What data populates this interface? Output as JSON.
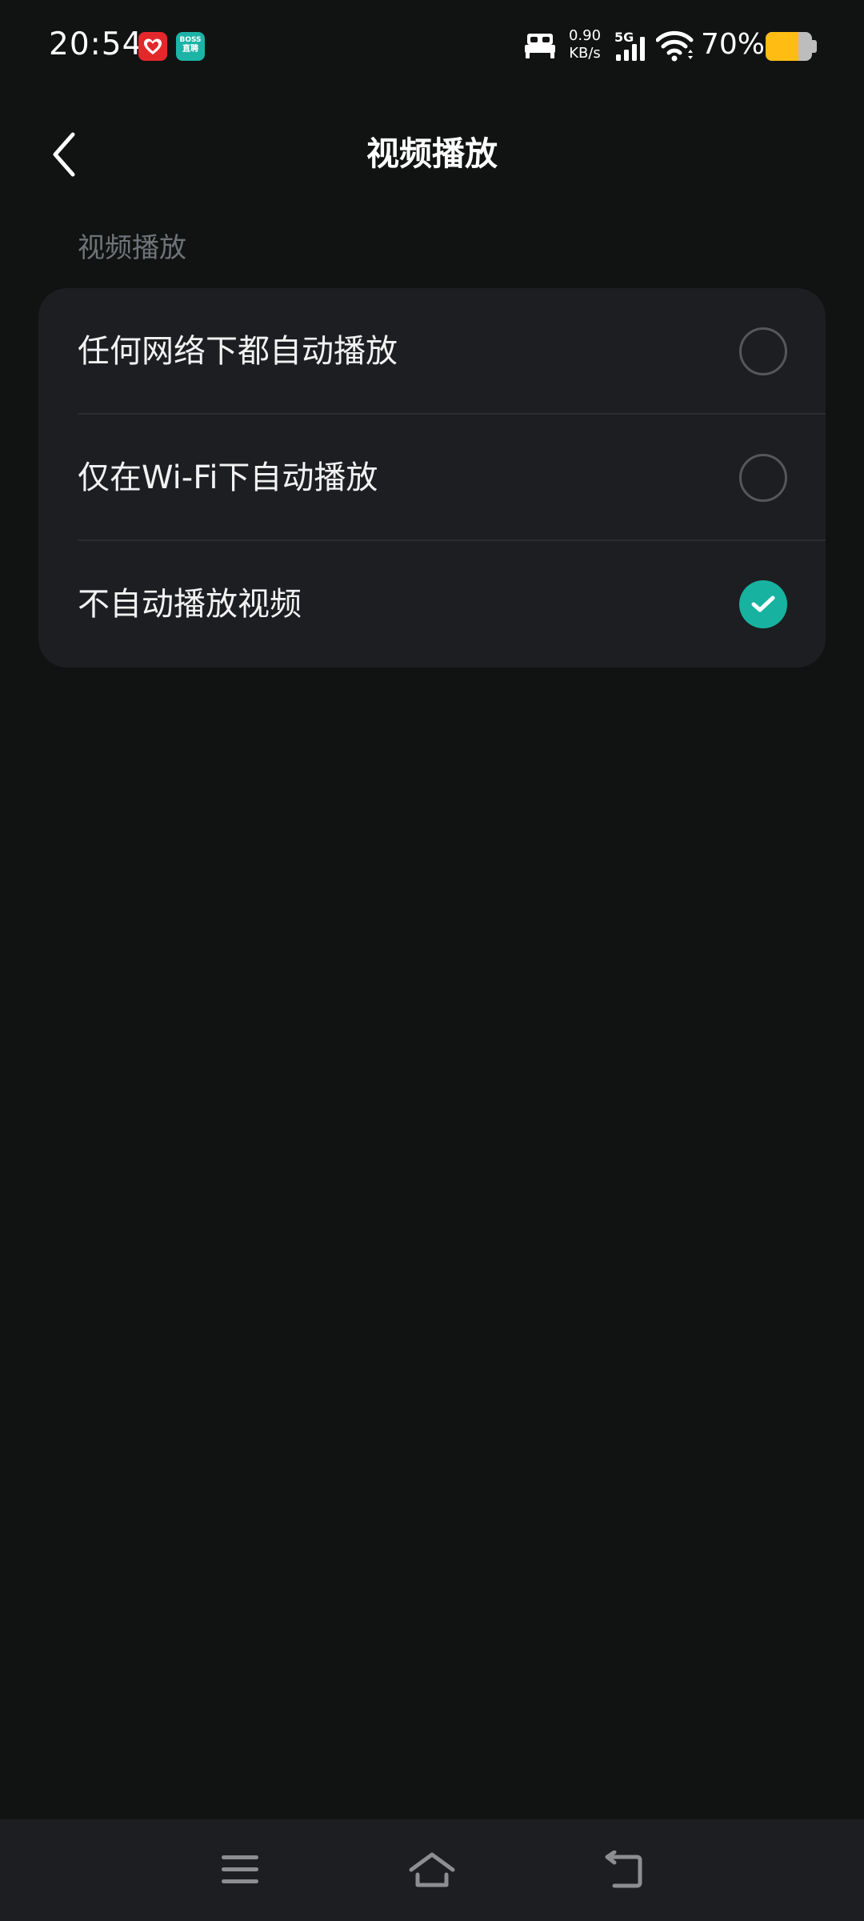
{
  "status_bar": {
    "time": "20:54",
    "network_speed_value": "0.90",
    "network_speed_unit": "KB/s",
    "network_type": "5G",
    "battery_percent": "70%",
    "battery_level": 0.7,
    "notification_icons": [
      "red-heart-app-icon",
      "boss-zhipin-app-icon"
    ],
    "boss_icon_text_top": "BOSS",
    "boss_icon_text_bottom": "直聘"
  },
  "header": {
    "title": "视频播放",
    "back_icon": "chevron-left-icon"
  },
  "section": {
    "label": "视频播放",
    "options": [
      {
        "label": "任何网络下都自动播放",
        "selected": false
      },
      {
        "label": "仅在Wi-Fi下自动播放",
        "selected": false
      },
      {
        "label": "不自动播放视频",
        "selected": true
      }
    ]
  },
  "colors": {
    "background": "#111313",
    "card": "#1d1e22",
    "accent": "#17b3a0",
    "battery": "#ffbd14"
  },
  "navigation_bar": {
    "icons": [
      "menu-icon",
      "home-icon",
      "back-icon"
    ]
  }
}
